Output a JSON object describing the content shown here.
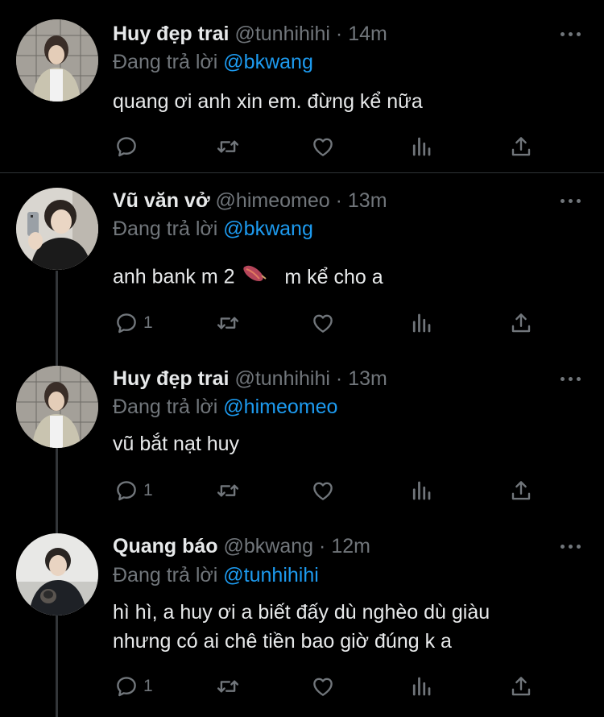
{
  "replying_label": "Đang trả lời",
  "colors": {
    "background": "#000000",
    "text": "#e7e9ea",
    "muted": "#71767b",
    "accent": "#1d9bf0"
  },
  "icons": [
    "more-icon",
    "reply-icon",
    "retweet-icon",
    "like-icon",
    "analytics-icon",
    "share-icon"
  ],
  "tweets": [
    {
      "name": "Huy đẹp trai",
      "handle": "@tunhihihi",
      "dot": "·",
      "time": "14m",
      "reply_to": "@bkwang",
      "text": "quang ơi anh xin em. đừng kể nữa",
      "reply_count": ""
    },
    {
      "name": "Vũ văn vở",
      "handle": "@himeomeo",
      "dot": "·",
      "time": "13m",
      "reply_to": "@bkwang",
      "text_before": "anh bank m 2",
      "emoji": "sweet-potato-emoji",
      "text_after": "m kể cho a",
      "reply_count": "1"
    },
    {
      "name": "Huy đẹp trai",
      "handle": "@tunhihihi",
      "dot": "·",
      "time": "13m",
      "reply_to": "@himeomeo",
      "text": "vũ bắt nạt huy",
      "reply_count": "1"
    },
    {
      "name": "Quang báo",
      "handle": "@bkwang",
      "dot": "·",
      "time": "12m",
      "reply_to": "@tunhihihi",
      "text_line1": "hì hì, a huy ơi a biết đấy dù nghèo dù giàu",
      "text_line2": "nhưng có ai chê tiền bao giờ đúng k a",
      "reply_count": "1"
    }
  ]
}
